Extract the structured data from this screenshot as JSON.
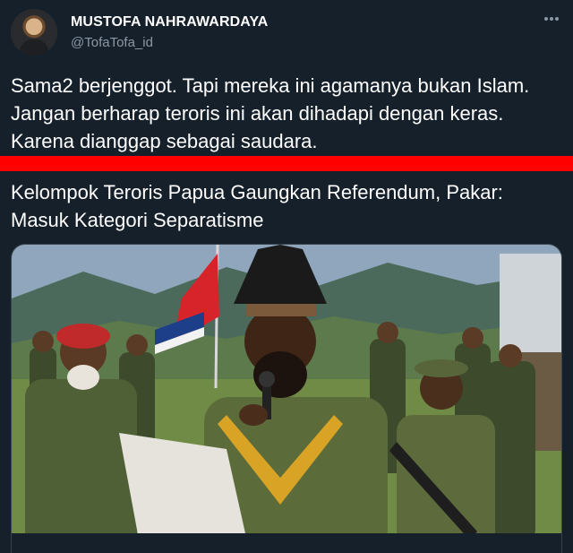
{
  "tweet": {
    "author_name": "MUSTOFA NAHRAWARDAYA",
    "author_handle": "@TofaTofa_id",
    "more_icon": "more-dots-icon",
    "text": "Sama2 berjenggot. Tapi mereka ini agamanya bukan Islam. Jangan berharap teroris ini akan dihadapi dengan keras. Karena dianggap sebagai saudara."
  },
  "article": {
    "title": "Kelompok Teroris Papua Gaungkan Referendum, Pakar: Masuk Kategori Separatisme"
  },
  "colors": {
    "background": "#15202b",
    "secondary_text": "#8b98a5",
    "highlight_line": "#ff0000"
  }
}
